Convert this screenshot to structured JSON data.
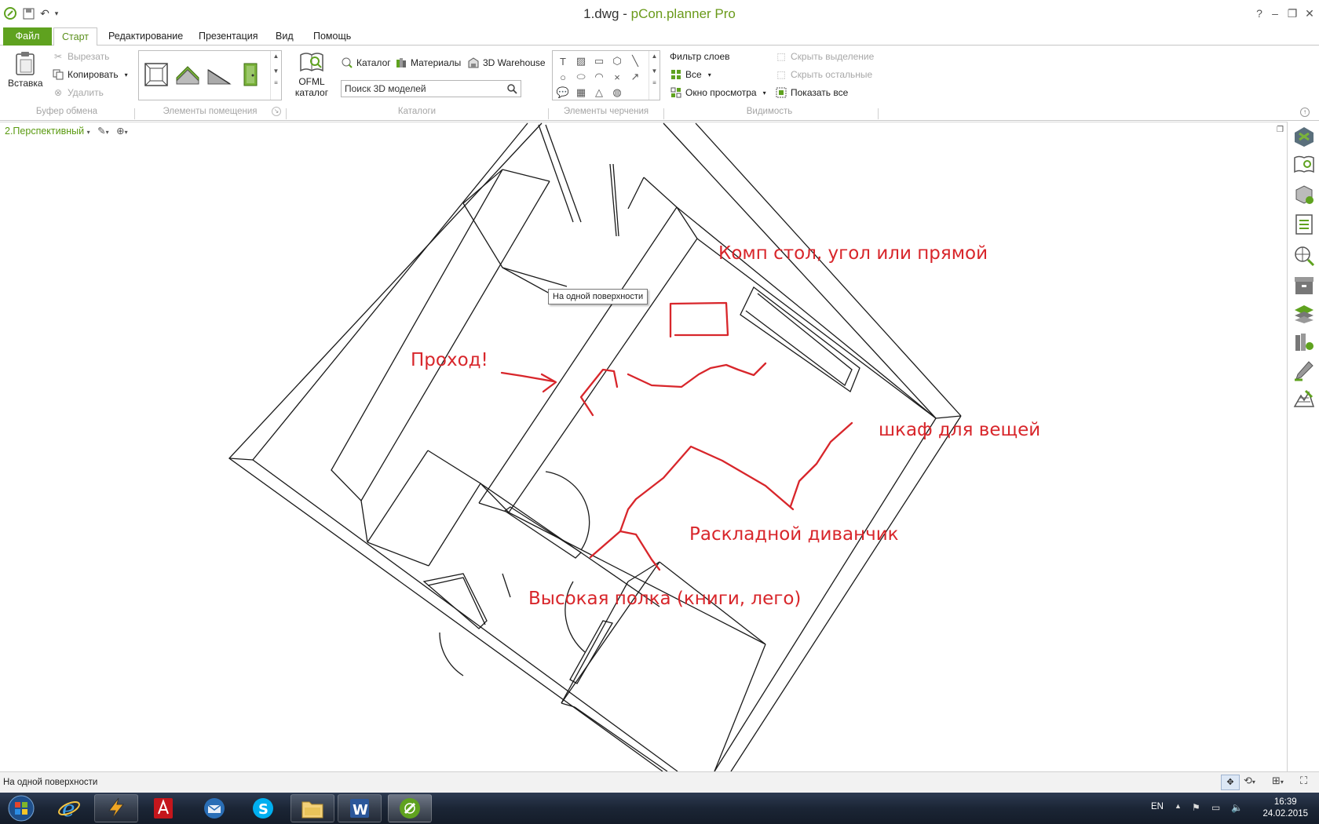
{
  "window": {
    "title_file": "1.dwg",
    "title_sep": " - ",
    "title_app": "pCon.planner Pro",
    "help_btn": "?",
    "min_btn": "–",
    "max_btn": "❐",
    "close_btn": "✕"
  },
  "tabs": [
    "Файл",
    "Старт",
    "Редактирование",
    "Презентация",
    "Вид",
    "Помощь"
  ],
  "ribbon": {
    "clipboard": {
      "paste": "Вставка",
      "cut": "Вырезать",
      "copy": "Копировать",
      "delete": "Удалить",
      "group": "Буфер обмена"
    },
    "room": {
      "group": "Элементы помещения"
    },
    "catalogs": {
      "ofml": "OFML каталог",
      "catalog": "Каталог",
      "materials": "Материалы",
      "warehouse": "3D Warehouse",
      "search_value": "Поиск 3D моделей",
      "group": "Каталоги"
    },
    "drawing": {
      "group": "Элементы черчения"
    },
    "visibility": {
      "layer_filter": "Фильтр слоев",
      "all": "Все",
      "viewport": "Окно просмотра",
      "hide_selection": "Скрыть выделение",
      "hide_others": "Скрыть остальные",
      "show_all": "Показать все",
      "group": "Видимость"
    }
  },
  "viewport": {
    "name": "2.Перспективный",
    "tooltip": "На одной поверхности"
  },
  "annotations": {
    "desk": "Комп стол, угол или прямой",
    "passage": "Проход!",
    "wardrobe": "шкаф для вещей",
    "sofa": "Раскладной диванчик",
    "shelf": "Высокая полка (книги, лего)"
  },
  "status": {
    "text": "На одной поверхности"
  },
  "taskbar": {
    "lang": "EN",
    "time": "16:39",
    "date": "24.02.2015"
  },
  "colors": {
    "accent": "#5fa21f",
    "annotation": "#d8262b",
    "taskbar": "#1b2535"
  }
}
